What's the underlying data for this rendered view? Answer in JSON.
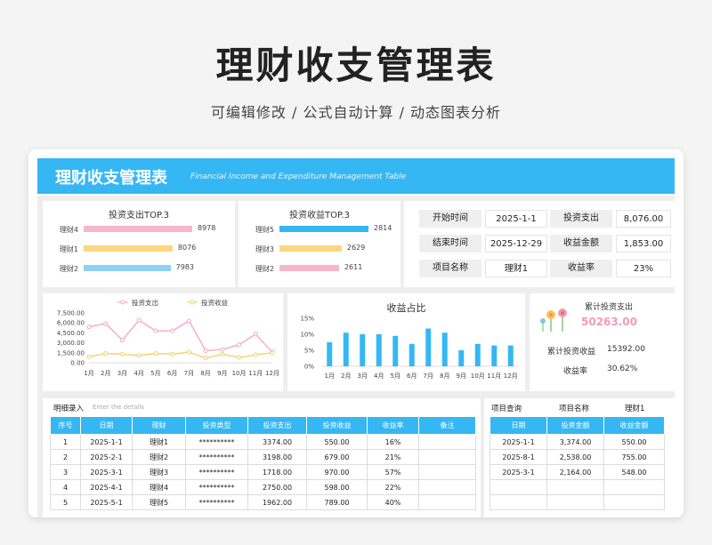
{
  "hero": {
    "title": "理财收支管理表",
    "subtitle": "可编辑修改 /  公式自动计算  /  动态图表分析"
  },
  "banner": {
    "title": "理财收支管理表",
    "subtitle_en": "Financial Income and Expenditure Management Table"
  },
  "colors": {
    "accent": "#35b7f4",
    "pink": "#f6b6cb",
    "yellow": "#fcd77f",
    "lightblue": "#8ed1f2",
    "value_pink": "#f39bb5"
  },
  "chart_data": [
    {
      "type": "bar",
      "orientation": "horizontal",
      "title": "投资支出TOP.3",
      "categories": [
        "理财4",
        "理财1",
        "理财2"
      ],
      "values": [
        8978,
        8076,
        7983
      ]
    },
    {
      "type": "bar",
      "orientation": "horizontal",
      "title": "投资收益TOP.3",
      "categories": [
        "理财5",
        "理财3",
        "理财2"
      ],
      "values": [
        2814,
        2629,
        2611
      ]
    },
    {
      "type": "line",
      "title": "",
      "categories": [
        "1月",
        "2月",
        "3月",
        "4月",
        "5月",
        "6月",
        "7月",
        "8月",
        "9月",
        "10月",
        "11月",
        "12月"
      ],
      "yticks": [
        "7,500.00",
        "6,000.00",
        "4,500.00",
        "3,000.00",
        "1,500.00",
        "0.00"
      ],
      "ylim": [
        0,
        7500
      ],
      "legend_position": "top",
      "series": [
        {
          "name": "投资支出",
          "color": "#f6a9c3",
          "values": [
            5400,
            5900,
            3400,
            6400,
            4800,
            4800,
            6300,
            1800,
            2000,
            2700,
            4300,
            1600
          ]
        },
        {
          "name": "投资收益",
          "color": "#f5d06b",
          "values": [
            900,
            1400,
            1300,
            1100,
            1400,
            1300,
            1600,
            700,
            1300,
            800,
            1200,
            1500
          ]
        }
      ]
    },
    {
      "type": "bar",
      "title": "收益占比",
      "categories": [
        "1月",
        "2月",
        "3月",
        "4月",
        "5月",
        "6月",
        "7月",
        "8月",
        "9月",
        "10月",
        "11月",
        "12月"
      ],
      "yticks": [
        "15%",
        "10%",
        "5%",
        "0%"
      ],
      "ylim": [
        0,
        15
      ],
      "values": [
        7.5,
        10.5,
        10,
        10,
        9.5,
        7,
        11.8,
        10.5,
        5,
        7,
        6.5,
        6.5
      ]
    }
  ],
  "info": {
    "start_label": "开始时间",
    "start_value": "2025-1-1",
    "end_label": "结束时间",
    "end_value": "2025-12-29",
    "name_label": "项目名称",
    "name_value": "理财1",
    "spend_label": "投资支出",
    "spend_value": "8,076.00",
    "income_label": "收益金额",
    "income_value": "1,853.00",
    "rate_label": "收益率",
    "rate_value": "23%"
  },
  "stats": {
    "total_spend_label": "累计投资支出",
    "total_spend_value": "50263.00",
    "total_income_label": "累计投资收益",
    "total_income_value": "15392.00",
    "rate_label": "收益率",
    "rate_value": "30.62%"
  },
  "detail": {
    "label": "明细录入",
    "placeholder": "Enter the details",
    "headers": [
      "序号",
      "日期",
      "理财",
      "投资类型",
      "投资支出",
      "投资收益",
      "收益率",
      "备注"
    ],
    "rows": [
      [
        "1",
        "2025-1-1",
        "理财1",
        "**********",
        "3374.00",
        "550.00",
        "16%",
        ""
      ],
      [
        "2",
        "2025-2-1",
        "理财2",
        "**********",
        "3198.00",
        "679.00",
        "21%",
        ""
      ],
      [
        "3",
        "2025-3-1",
        "理财3",
        "**********",
        "1718.00",
        "970.00",
        "57%",
        ""
      ],
      [
        "4",
        "2025-4-1",
        "理财4",
        "**********",
        "2750.00",
        "598.00",
        "22%",
        ""
      ],
      [
        "5",
        "2025-5-1",
        "理财5",
        "**********",
        "1962.00",
        "789.00",
        "40%",
        ""
      ]
    ]
  },
  "query": {
    "label": "项目查询",
    "name_label": "项目名称",
    "name_value": "理财1",
    "headers": [
      "日期",
      "投资金额",
      "收益金额"
    ],
    "rows": [
      [
        "2025-1-1",
        "3,374.00",
        "550.00"
      ],
      [
        "2025-8-1",
        "2,538.00",
        "755.00"
      ],
      [
        "2025-3-1",
        "2,164.00",
        "548.00"
      ],
      [
        "",
        "",
        ""
      ],
      [
        "",
        "",
        ""
      ]
    ]
  }
}
